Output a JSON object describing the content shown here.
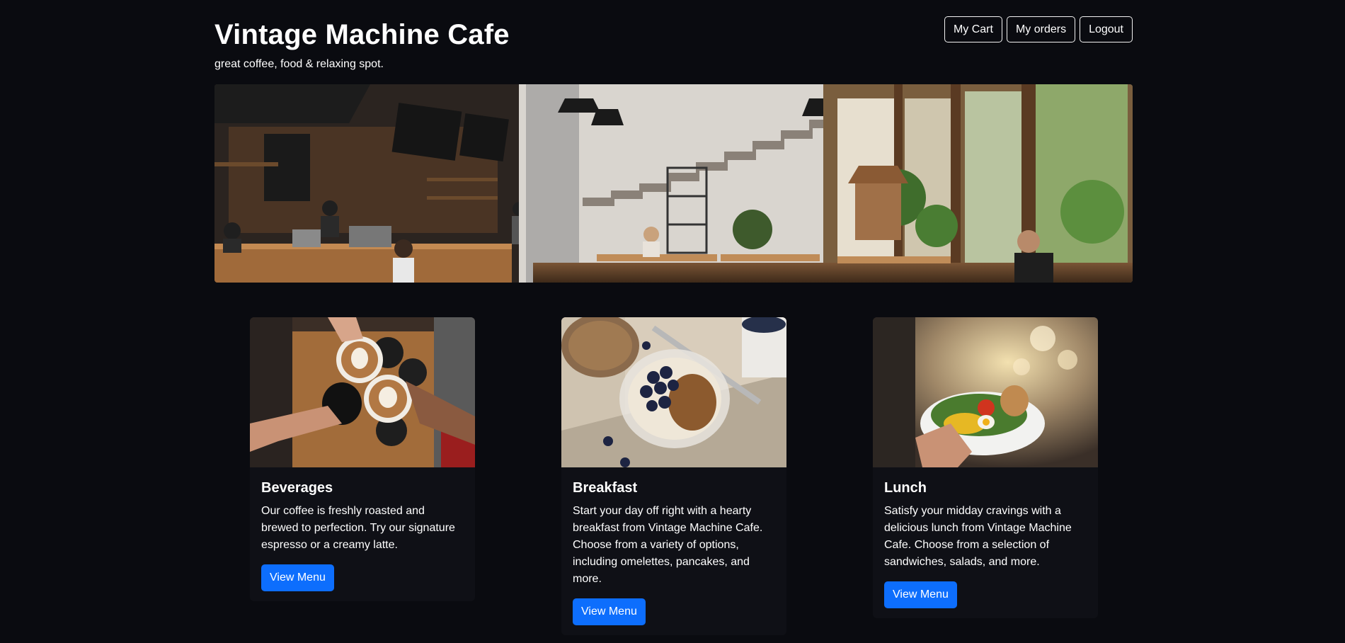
{
  "header": {
    "title": "Vintage Machine Cafe",
    "tagline": "great coffee, food & relaxing spot."
  },
  "nav": {
    "cart": "My Cart",
    "orders": "My orders",
    "logout": "Logout"
  },
  "cards": [
    {
      "title": "Beverages",
      "text": "Our coffee is freshly roasted and brewed to perfection. Try our signature espresso or a creamy latte.",
      "button": "View Menu"
    },
    {
      "title": "Breakfast",
      "text": "Start your day off right with a hearty breakfast from Vintage Machine Cafe. Choose from a variety of options, including omelettes, pancakes, and more.",
      "button": "View Menu"
    },
    {
      "title": "Lunch",
      "text": "Satisfy your midday cravings with a delicious lunch from Vintage Machine Cafe. Choose from a selection of sandwiches, salads, and more.",
      "button": "View Menu"
    }
  ],
  "colors": {
    "background": "#0a0b10",
    "card": "#0f1016",
    "primary": "#0d6efd",
    "text": "#ffffff"
  }
}
